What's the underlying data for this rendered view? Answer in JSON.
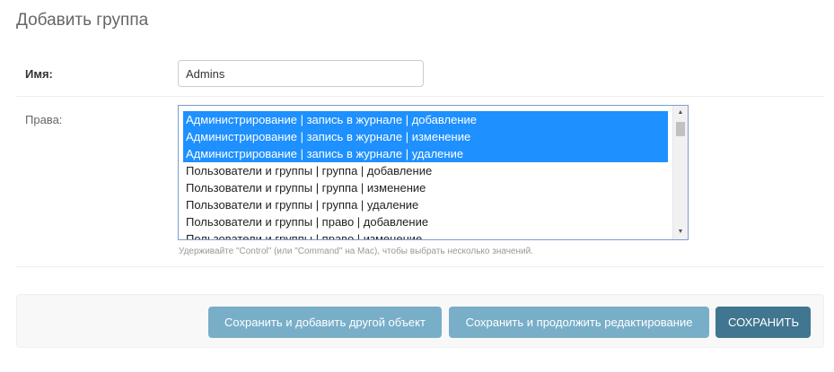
{
  "page": {
    "title": "Добавить группа"
  },
  "form": {
    "name": {
      "label": "Имя:",
      "value": "Admins"
    },
    "permissions": {
      "label": "Права:",
      "options": [
        {
          "label": "Администрирование | запись в журнале | добавление",
          "selected": true
        },
        {
          "label": "Администрирование | запись в журнале | изменение",
          "selected": true
        },
        {
          "label": "Администрирование | запись в журнале | удаление",
          "selected": true
        },
        {
          "label": "Пользователи и группы | группа | добавление",
          "selected": false
        },
        {
          "label": "Пользователи и группы | группа | изменение",
          "selected": false
        },
        {
          "label": "Пользователи и группы | группа | удаление",
          "selected": false
        },
        {
          "label": "Пользователи и группы | право | добавление",
          "selected": false
        },
        {
          "label": "Пользователи и группы | право | изменение",
          "selected": false
        }
      ],
      "help_text": "Удерживайте \"Control\" (или \"Command\" на Mac), чтобы выбрать несколько значений."
    }
  },
  "buttons": {
    "save_add_another": "Сохранить и добавить другой объект",
    "save_continue": "Сохранить и продолжить редактирование",
    "save": "СОХРАНИТЬ"
  },
  "colors": {
    "selected_option": "#1e90ff",
    "button_secondary": "#79aec8",
    "button_primary": "#417690"
  }
}
